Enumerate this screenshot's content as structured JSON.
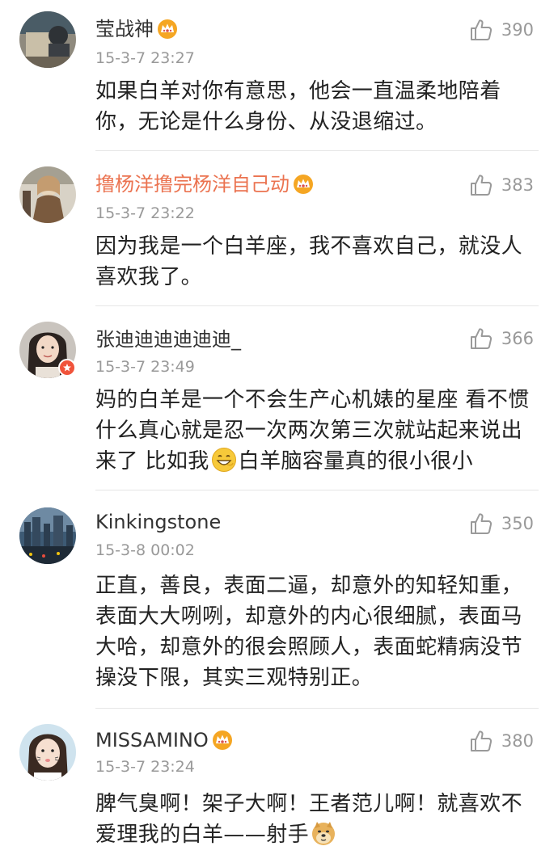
{
  "comments": [
    {
      "username": "莹战神",
      "timestamp": "15-3-7 23:27",
      "likes": "390",
      "text": "如果白羊对你有意思，他会一直温柔地陪着你，无论是什么身份、从没退缩过。",
      "vip": true,
      "verified": false
    },
    {
      "username": "撸杨洋撸完杨洋自己动",
      "timestamp": "15-3-7 23:22",
      "likes": "383",
      "text": "因为我是一个白羊座，我不喜欢自己，就没人喜欢我了。",
      "vip": true,
      "verified": false
    },
    {
      "username": "张迪迪迪迪迪迪_",
      "timestamp": "15-3-7 23:49",
      "likes": "366",
      "text_before_emoji": "妈的白羊是一个不会生产心机婊的星座 看不惯什么真心就是忍一次两次第三次就站起来说出来了 比如我",
      "emoji": "grin-emoji",
      "text_after_emoji": "白羊脑容量真的很小很小",
      "vip": false,
      "verified": true
    },
    {
      "username": "Kinkingstone",
      "timestamp": "15-3-8 00:02",
      "likes": "350",
      "text": "正直，善良，表面二逼，却意外的知轻知重，表面大大咧咧，却意外的内心很细腻，表面马大哈，却意外的很会照顾人，表面蛇精病没节操没下限，其实三观特别正。",
      "vip": false,
      "verified": false
    },
    {
      "username": "MISSAMINO",
      "timestamp": "15-3-7 23:24",
      "likes": "380",
      "text_before_emoji": "脾气臭啊！架子大啊！王者范儿啊！就喜欢不爱理我的白羊——射手",
      "emoji": "doge-emoji",
      "text_after_emoji": "",
      "vip": true,
      "verified": false
    }
  ],
  "colors": {
    "vip_name": "#eb7350",
    "normal_name": "#333333",
    "meta": "#999999",
    "body_text": "#222222",
    "divider": "#e6e6e6",
    "crown": "#f5a623",
    "verified_badge": "#f0533b"
  },
  "icons": {
    "like": "thumbs-up-icon",
    "vip": "crown-icon",
    "verified": "verified-badge-icon"
  }
}
